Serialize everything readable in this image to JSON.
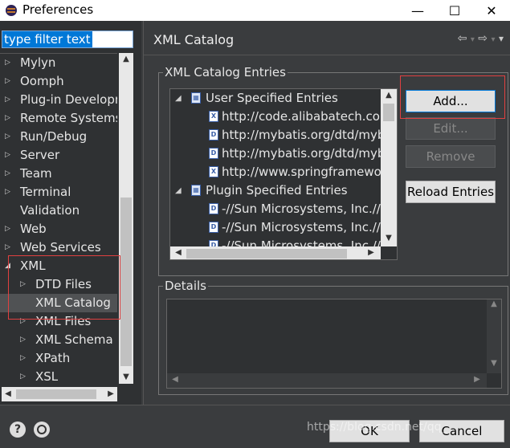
{
  "window": {
    "title": "Preferences",
    "minimize": "—",
    "maximize": "☐",
    "close": "✕"
  },
  "filter": {
    "value": "type filter text"
  },
  "tree": [
    {
      "label": "Mylyn",
      "arrow": "▷",
      "level": 0
    },
    {
      "label": "Oomph",
      "arrow": "▷",
      "level": 0
    },
    {
      "label": "Plug-in Developm",
      "arrow": "▷",
      "level": 0
    },
    {
      "label": "Remote Systems",
      "arrow": "▷",
      "level": 0
    },
    {
      "label": "Run/Debug",
      "arrow": "▷",
      "level": 0
    },
    {
      "label": "Server",
      "arrow": "▷",
      "level": 0
    },
    {
      "label": "Team",
      "arrow": "▷",
      "level": 0
    },
    {
      "label": "Terminal",
      "arrow": "▷",
      "level": 0
    },
    {
      "label": "Validation",
      "arrow": "",
      "level": 0
    },
    {
      "label": "Web",
      "arrow": "▷",
      "level": 0
    },
    {
      "label": "Web Services",
      "arrow": "▷",
      "level": 0
    },
    {
      "label": "XML",
      "arrow": "◢",
      "level": 0
    },
    {
      "label": "DTD Files",
      "arrow": "▷",
      "level": 1
    },
    {
      "label": "XML Catalog",
      "arrow": "",
      "level": 1,
      "selected": true
    },
    {
      "label": "XML Files",
      "arrow": "▷",
      "level": 1
    },
    {
      "label": "XML Schema F",
      "arrow": "▷",
      "level": 1
    },
    {
      "label": "XPath",
      "arrow": "▷",
      "level": 1
    },
    {
      "label": "XSL",
      "arrow": "▷",
      "level": 1
    }
  ],
  "page": {
    "title": "XML Catalog",
    "nav": {
      "back": "⇦",
      "forward": "⇨",
      "menu": "▾",
      "dropdown": "▾"
    },
    "entries_group_label": "XML Catalog Entries",
    "details_group_label": "Details"
  },
  "entries": [
    {
      "label": "User Specified Entries",
      "type": "folder",
      "arrow": "◢",
      "level": 0
    },
    {
      "label": "http://code.alibabatech.com",
      "type": "xsd",
      "icon": "X",
      "level": 1
    },
    {
      "label": "http://mybatis.org/dtd/myb",
      "type": "dtd",
      "icon": "D",
      "level": 1
    },
    {
      "label": "http://mybatis.org/dtd/myb",
      "type": "dtd",
      "icon": "D",
      "level": 1
    },
    {
      "label": "http://www.springframewo",
      "type": "xsd",
      "icon": "X",
      "level": 1
    },
    {
      "label": "Plugin Specified Entries",
      "type": "folder",
      "arrow": "◢",
      "level": 0
    },
    {
      "label": "-//Sun Microsystems, Inc.//",
      "type": "dtd",
      "icon": "D",
      "level": 1
    },
    {
      "label": "-//Sun Microsystems, Inc.//",
      "type": "dtd",
      "icon": "D",
      "level": 1
    },
    {
      "label": "-//Sun Microsystems, Inc.//",
      "type": "dtd",
      "icon": "D",
      "level": 1
    }
  ],
  "buttons": {
    "add": "Add...",
    "edit": "Edit...",
    "remove": "Remove",
    "reload": "Reload Entries"
  },
  "footer": {
    "help": "?",
    "ok": "OK",
    "cancel": "Cancel",
    "watermark": "https://blog.csdn.net/qq_"
  },
  "colors": {
    "highlight_box": "#e04040",
    "selection": "#0078d7"
  }
}
